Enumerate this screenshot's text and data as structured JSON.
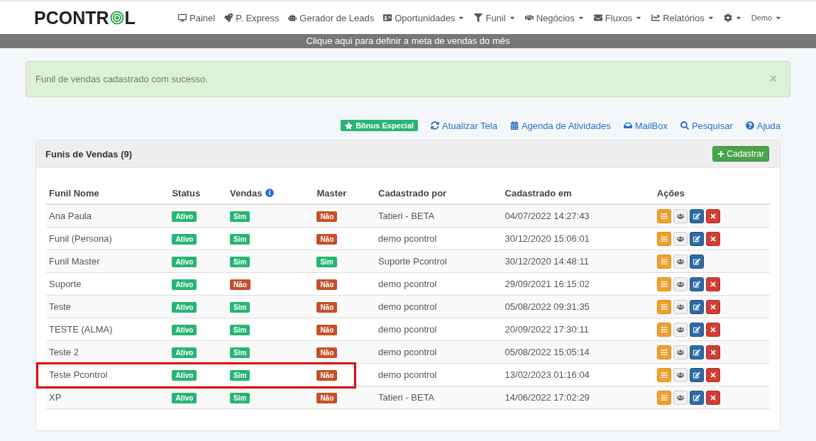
{
  "logo": {
    "before": "PCONTR",
    "after": "L"
  },
  "nav": [
    {
      "label": "Painel",
      "dropdown": false
    },
    {
      "label": "P. Express",
      "dropdown": false
    },
    {
      "label": "Gerador de Leads",
      "dropdown": false
    },
    {
      "label": "Oportunidades",
      "dropdown": true
    },
    {
      "label": "Funil",
      "dropdown": true
    },
    {
      "label": "Negócios",
      "dropdown": true
    },
    {
      "label": "Fluxos",
      "dropdown": true
    },
    {
      "label": "Relatórios",
      "dropdown": true
    },
    {
      "dropdown": true
    },
    {
      "label": "Demo",
      "dropdown": true
    }
  ],
  "goal_banner": "Clique aqui para definir a meta de vendas do mês",
  "alert": {
    "message": "Funil de vendas cadastrado com sucesso.",
    "close": "×"
  },
  "bonus": "Bônus Especial",
  "toolbar": [
    "Atualizar Tela",
    "Agenda de Atividades",
    "MailBox",
    "Pesquisar",
    "Ajuda"
  ],
  "panel": {
    "title": "Funis de Vendas (9)",
    "add_button": "Cadastrar"
  },
  "table": {
    "columns": [
      "Funil Nome",
      "Status",
      "Vendas",
      "Master",
      "Cadastrado por",
      "Cadastrado em",
      "Ações"
    ],
    "rows": [
      {
        "name": "Ana Paula",
        "status": {
          "label": "Ativo",
          "on": true
        },
        "vendas": {
          "label": "Sim",
          "on": true
        },
        "master": {
          "label": "Não",
          "on": false
        },
        "by": "Tatieri - BETA",
        "at": "04/07/2022 14:27:43",
        "can_delete": true,
        "highlighted": false
      },
      {
        "name": "Funil (Persona)",
        "status": {
          "label": "Ativo",
          "on": true
        },
        "vendas": {
          "label": "Sim",
          "on": true
        },
        "master": {
          "label": "Não",
          "on": false
        },
        "by": "demo pcontrol",
        "at": "30/12/2020 15:06:01",
        "can_delete": true,
        "highlighted": false
      },
      {
        "name": "Funil Master",
        "status": {
          "label": "Ativo",
          "on": true
        },
        "vendas": {
          "label": "Sim",
          "on": true
        },
        "master": {
          "label": "Sim",
          "on": true
        },
        "by": "Suporte Pcontrol",
        "at": "30/12/2020 14:48:11",
        "can_delete": false,
        "highlighted": false
      },
      {
        "name": "Suporte",
        "status": {
          "label": "Ativo",
          "on": true
        },
        "vendas": {
          "label": "Não",
          "on": false
        },
        "master": {
          "label": "Não",
          "on": false
        },
        "by": "demo pcontrol",
        "at": "29/09/2021 16:15:02",
        "can_delete": true,
        "highlighted": false
      },
      {
        "name": "Teste",
        "status": {
          "label": "Ativo",
          "on": true
        },
        "vendas": {
          "label": "Sim",
          "on": true
        },
        "master": {
          "label": "Não",
          "on": false
        },
        "by": "demo pcontrol",
        "at": "05/08/2022 09:31:35",
        "can_delete": true,
        "highlighted": false
      },
      {
        "name": "TESTE (ALMA)",
        "status": {
          "label": "Ativo",
          "on": true
        },
        "vendas": {
          "label": "Sim",
          "on": true
        },
        "master": {
          "label": "Não",
          "on": false
        },
        "by": "demo pcontrol",
        "at": "20/09/2022 17:30:11",
        "can_delete": true,
        "highlighted": false
      },
      {
        "name": "Teste 2",
        "status": {
          "label": "Ativo",
          "on": true
        },
        "vendas": {
          "label": "Sim",
          "on": true
        },
        "master": {
          "label": "Não",
          "on": false
        },
        "by": "demo pcontrol",
        "at": "05/08/2022 15:05:14",
        "can_delete": true,
        "highlighted": false
      },
      {
        "name": "Teste Pcontrol",
        "status": {
          "label": "Ativo",
          "on": true
        },
        "vendas": {
          "label": "Sim",
          "on": true
        },
        "master": {
          "label": "Não",
          "on": false
        },
        "by": "demo pcontrol",
        "at": "13/02/2023 01:16:04",
        "can_delete": true,
        "highlighted": true
      },
      {
        "name": "XP",
        "status": {
          "label": "Ativo",
          "on": true
        },
        "vendas": {
          "label": "Sim",
          "on": true
        },
        "master": {
          "label": "Não",
          "on": false
        },
        "by": "Tatieri - BETA",
        "at": "14/06/2022 17:02:29",
        "can_delete": true,
        "highlighted": false
      }
    ]
  }
}
